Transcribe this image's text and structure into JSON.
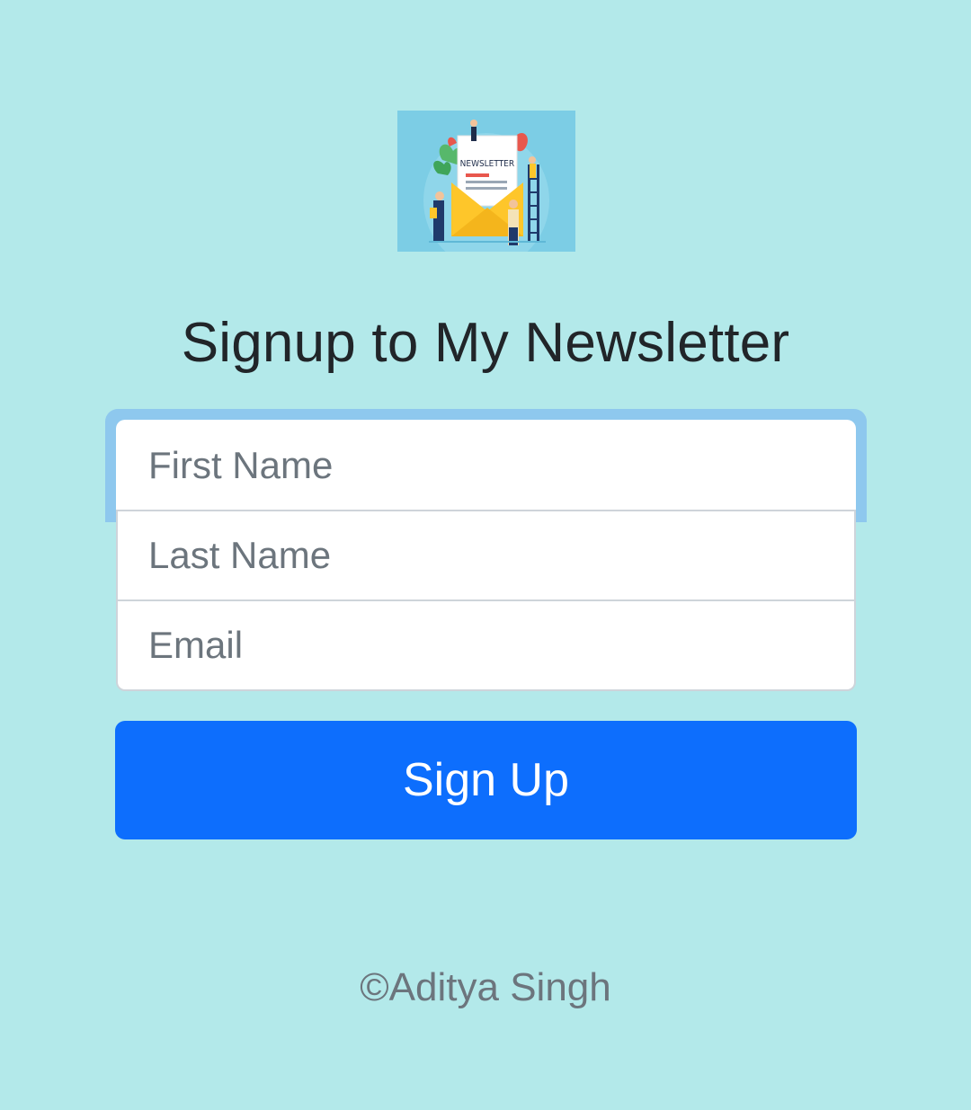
{
  "logo": {
    "text": "NEWSLETTER",
    "icon": "newsletter-envelope-illustration",
    "colors": {
      "background": "#7ccde5",
      "envelope": "#fec62a",
      "paper": "#ffffff"
    }
  },
  "title": "Signup to My Newsletter",
  "form": {
    "first_name": {
      "placeholder": "First Name",
      "value": ""
    },
    "last_name": {
      "placeholder": "Last Name",
      "value": ""
    },
    "email": {
      "placeholder": "Email",
      "value": ""
    }
  },
  "signup_button": {
    "label": "Sign Up",
    "color": "#0d6efd"
  },
  "footer": {
    "text": "©Aditya Singh"
  },
  "colors": {
    "page_background": "#b3e9ea",
    "focus_ring": "#8ec8ee"
  }
}
